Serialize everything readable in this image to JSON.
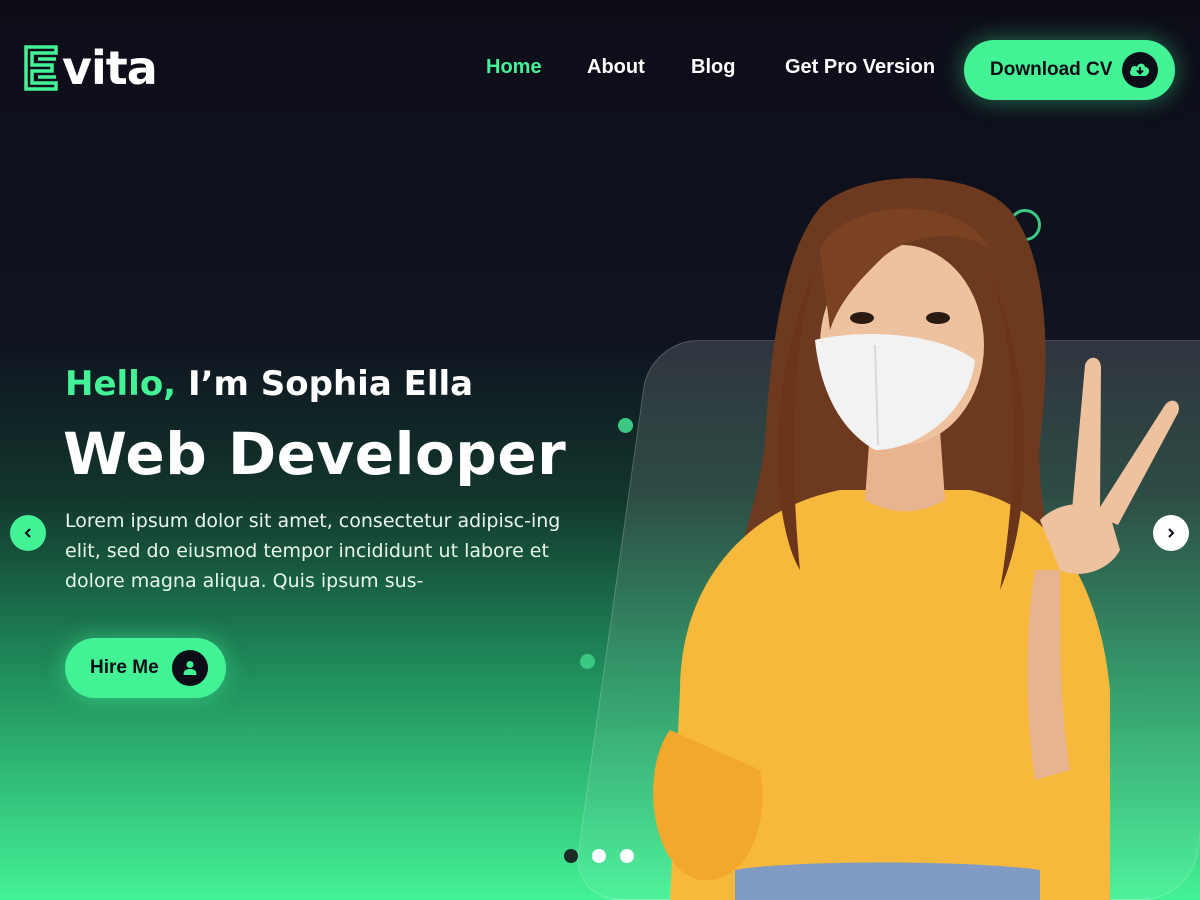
{
  "brand": {
    "logo_text": "vita",
    "logo_letter": "E"
  },
  "nav": {
    "home": "Home",
    "about": "About",
    "blog": "Blog",
    "pro": "Get Pro Version"
  },
  "download_button": {
    "label": "Download CV",
    "icon": "cloud-download-icon"
  },
  "hero": {
    "greeting_highlight": "Hello,",
    "greeting_rest": " I’m Sophia Ella",
    "role": "Web Developer",
    "description": "Lorem ipsum dolor sit amet, consectetur adipisc-ing elit, sed do eiusmod tempor incididunt ut labore et dolore magna aliqua. Quis ipsum sus-",
    "hire_button": {
      "label": "Hire Me",
      "icon": "user-icon"
    }
  },
  "slider": {
    "prev_icon": "chevron-left-icon",
    "next_icon": "chevron-right-icon",
    "slide_count": 3,
    "active_index": 0
  },
  "colors": {
    "accent": "#44f296",
    "dark": "#0d0d18",
    "shirt": "#f6b93b"
  }
}
